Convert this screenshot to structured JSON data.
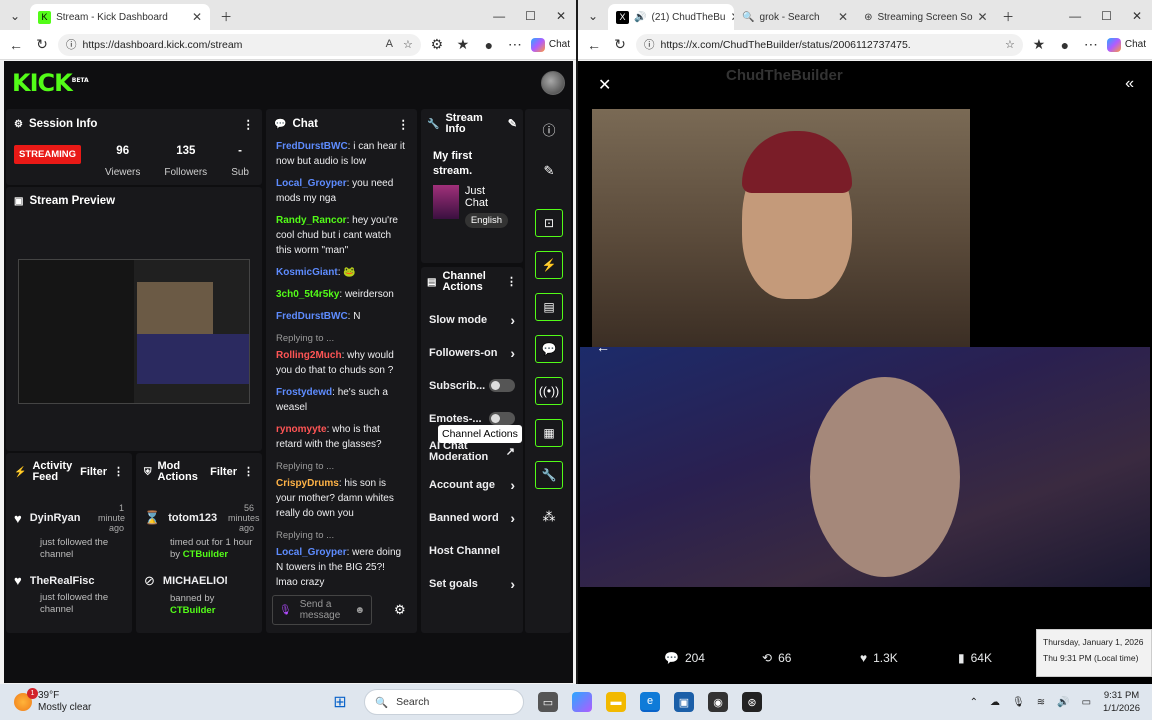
{
  "left_window": {
    "tabs": [
      {
        "title": "Stream - Kick Dashboard",
        "active": true
      }
    ],
    "url": "https://dashboard.kick.com/stream",
    "chat_button": "Chat",
    "kick": {
      "logo": "KICK",
      "logo_badge": "BETA",
      "session_info": {
        "title": "Session Info",
        "status": "STREAMING",
        "viewers": "96",
        "viewers_label": "Viewers",
        "followers": "135",
        "followers_label": "Followers",
        "subs": "-",
        "subs_label": "Sub"
      },
      "preview": {
        "title": "Stream Preview"
      },
      "chat": {
        "title": "Chat",
        "input_placeholder": "Send a message",
        "messages": [
          {
            "user": "FredDurstBWC",
            "text": "i can hear it now but audio is low",
            "color": "u1"
          },
          {
            "user": "Local_Groyper",
            "text": "you need mods my nga",
            "color": "u1"
          },
          {
            "user": "Randy_Rancor",
            "text": "hey you're cool chud but i cant watch this worm \"man\"",
            "color": "u2"
          },
          {
            "user": "KosmicGiant",
            "text": "🐸",
            "color": "u1"
          },
          {
            "user": "3ch0_5t4r5ky",
            "text": "weirderson",
            "color": "u2"
          },
          {
            "user": "FredDurstBWC",
            "text": "N",
            "color": "u1"
          },
          {
            "reply": "Replying to ...",
            "user": "Rolling2Much",
            "text": "why would you do that to chuds son ?",
            "color": "u3"
          },
          {
            "user": "Frostydewd",
            "text": "he's such a weasel",
            "color": "u1"
          },
          {
            "user": "rynomyyte",
            "text": "who is that retard with the glasses?",
            "color": "u3"
          },
          {
            "reply": "Replying to ...",
            "user": "CrispyDrums",
            "text": "his son is your mother? damn whites really do own you",
            "color": "u4"
          },
          {
            "reply": "Replying to ...",
            "user": "Local_Groyper",
            "text": "were doing N towers in the BIG 25?! lmao crazy",
            "color": "u1"
          }
        ]
      },
      "stream_info": {
        "title": "Stream Info",
        "stream_title": "My first stream.",
        "category": "Just Chat",
        "language": "English"
      },
      "channel_actions": {
        "title": "Channel Actions",
        "items": [
          {
            "label": "Slow mode",
            "control": "chevron"
          },
          {
            "label": "Followers-on",
            "control": "chevron"
          },
          {
            "label": "Subscrib...",
            "control": "toggle"
          },
          {
            "label": "Emotes-...",
            "control": "toggle"
          },
          {
            "label": "AI Chat Moderation",
            "control": "external"
          },
          {
            "label": "Account age",
            "control": "chevron"
          },
          {
            "label": "Banned word",
            "control": "chevron"
          },
          {
            "label": "Host Channel",
            "control": "none"
          },
          {
            "label": "Set goals",
            "control": "chevron"
          }
        ],
        "tooltip": "Channel Actions"
      },
      "activity_feed": {
        "title": "Activity Feed",
        "filter": "Filter",
        "items": [
          {
            "name": "DyinRyan",
            "time": "1 minute ago",
            "desc": "just followed the channel"
          },
          {
            "name": "TheRealFischgr",
            "time": "",
            "desc": "just followed the channel"
          }
        ]
      },
      "mod_actions": {
        "title": "Mod Actions",
        "filter": "Filter",
        "items": [
          {
            "name": "totom123",
            "time": "56 minutes ago",
            "desc": "timed out for 1 hour by",
            "by": "CTBuilder"
          },
          {
            "name": "MICHAELIONHE",
            "time": "",
            "desc": "banned by",
            "by": "CTBuilder"
          }
        ]
      }
    }
  },
  "right_window": {
    "tabs": [
      {
        "title": "(21) ChudTheBu",
        "active": true
      },
      {
        "title": "grok - Search",
        "active": false
      },
      {
        "title": "Streaming Screen So",
        "active": false
      }
    ],
    "url": "https://x.com/ChudTheBuilder/status/2006112737475...",
    "chat_button": "Chat",
    "header_name": "ChudTheBuilder",
    "stats": {
      "replies": "204",
      "reposts": "66",
      "likes": "1.3K",
      "views": "64K"
    },
    "date_tooltip": {
      "line1": "Thursday, January 1, 2026",
      "line2": "Thu 9:31 PM (Local time)"
    }
  },
  "taskbar": {
    "weather_temp": "39°F",
    "weather_desc": "Mostly clear",
    "weather_badge": "1",
    "search": "Search",
    "time": "9:31 PM",
    "date": "1/1/2026"
  }
}
